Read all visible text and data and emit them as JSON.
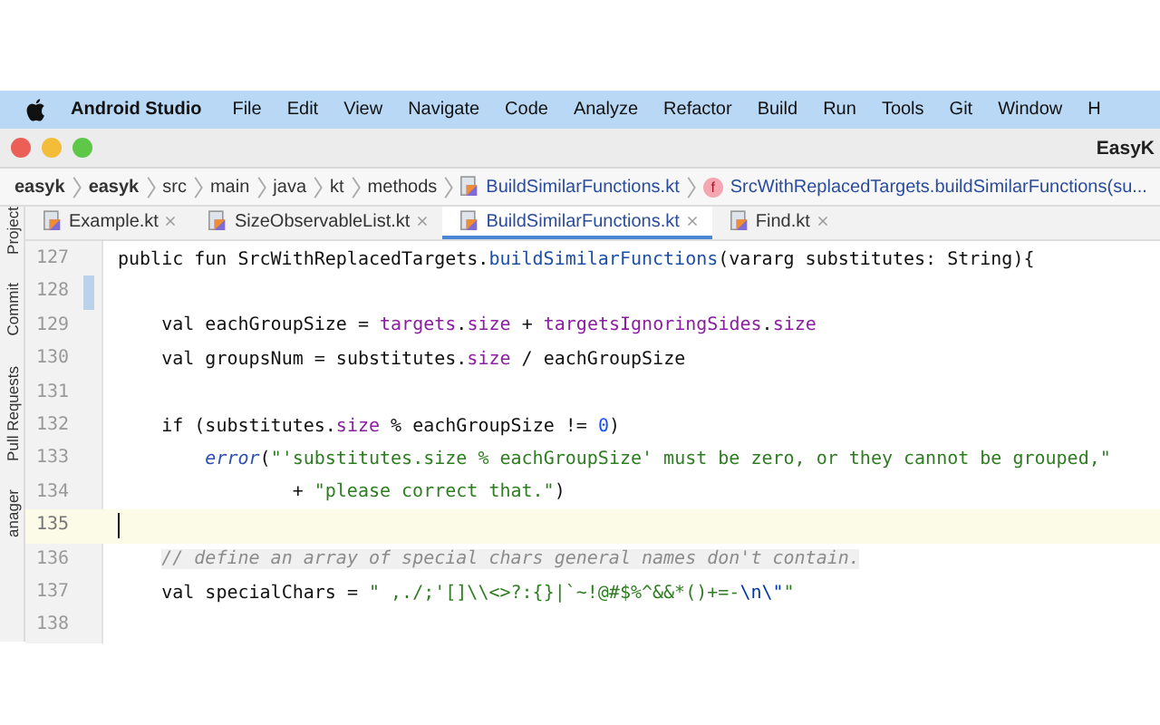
{
  "menu_bar": {
    "app_name": "Android Studio",
    "items": [
      "File",
      "Edit",
      "View",
      "Navigate",
      "Code",
      "Analyze",
      "Refactor",
      "Build",
      "Run",
      "Tools",
      "Git",
      "Window",
      "H"
    ]
  },
  "window": {
    "title": "EasyK"
  },
  "breadcrumb": [
    {
      "label": "easyk",
      "kind": "module"
    },
    {
      "label": "easyk",
      "kind": "module"
    },
    {
      "label": "src",
      "kind": "folder"
    },
    {
      "label": "main",
      "kind": "folder"
    },
    {
      "label": "java",
      "kind": "folder"
    },
    {
      "label": "kt",
      "kind": "folder"
    },
    {
      "label": "methods",
      "kind": "folder"
    },
    {
      "label": "BuildSimilarFunctions.kt",
      "kind": "file"
    },
    {
      "label": "SrcWithReplacedTargets.buildSimilarFunctions(su...",
      "kind": "function",
      "icon_letter": "f"
    }
  ],
  "side_tools": [
    "Project",
    "Commit",
    "Pull Requests",
    "anager"
  ],
  "tabs": [
    {
      "label": "Example.kt",
      "selected": false
    },
    {
      "label": "SizeObservableList.kt",
      "selected": false
    },
    {
      "label": "BuildSimilarFunctions.kt",
      "selected": true
    },
    {
      "label": "Find.kt",
      "selected": false
    }
  ],
  "editor": {
    "lines": [
      {
        "number": "127",
        "current": false,
        "changed": false,
        "tokens": [
          {
            "kind": "plain",
            "text": "public fun SrcWithReplacedTargets."
          },
          {
            "kind": "call",
            "text": "buildSimilarFunctions"
          },
          {
            "kind": "plain",
            "text": "(vararg substitutes: String){"
          }
        ]
      },
      {
        "number": "128",
        "current": false,
        "changed": true
      },
      {
        "number": "129",
        "current": false,
        "changed": false,
        "tokens": [
          {
            "kind": "plain",
            "text": "    val eachGroupSize = "
          },
          {
            "kind": "prop",
            "text": "targets"
          },
          {
            "kind": "plain",
            "text": "."
          },
          {
            "kind": "prop",
            "text": "size"
          },
          {
            "kind": "plain",
            "text": " + "
          },
          {
            "kind": "prop",
            "text": "targetsIgnoringSides"
          },
          {
            "kind": "plain",
            "text": "."
          },
          {
            "kind": "prop",
            "text": "size"
          }
        ]
      },
      {
        "number": "130",
        "current": false,
        "changed": false,
        "tokens": [
          {
            "kind": "plain",
            "text": "    val groupsNum = substitutes."
          },
          {
            "kind": "prop",
            "text": "size"
          },
          {
            "kind": "plain",
            "text": " / eachGroupSize"
          }
        ]
      },
      {
        "number": "131",
        "current": false,
        "changed": false
      },
      {
        "number": "132",
        "current": false,
        "changed": false,
        "tokens": [
          {
            "kind": "plain",
            "text": "    if (substitutes."
          },
          {
            "kind": "prop",
            "text": "size"
          },
          {
            "kind": "plain",
            "text": " % eachGroupSize != "
          },
          {
            "kind": "number",
            "text": "0"
          },
          {
            "kind": "plain",
            "text": ")"
          }
        ]
      },
      {
        "number": "133",
        "current": false,
        "changed": false,
        "tokens": [
          {
            "kind": "fn_italic",
            "text": "        error"
          },
          {
            "kind": "plain",
            "text": "("
          },
          {
            "kind": "string",
            "text": "\"'substitutes.size % eachGroupSize' must be zero, or they cannot be grouped,\""
          }
        ]
      },
      {
        "number": "134",
        "current": false,
        "changed": false,
        "tokens": [
          {
            "kind": "plain",
            "text": "                + "
          },
          {
            "kind": "string",
            "text": "\"please correct that.\""
          },
          {
            "kind": "plain",
            "text": ")"
          }
        ]
      },
      {
        "number": "135",
        "current": true,
        "changed": false
      },
      {
        "number": "136",
        "current": false,
        "changed": false,
        "tokens": [
          {
            "kind": "comment",
            "text": "    // define an array of special chars general names don't contain."
          }
        ]
      },
      {
        "number": "137",
        "current": false,
        "changed": false,
        "tokens": [
          {
            "kind": "plain",
            "text": "    val specialChars = "
          },
          {
            "kind": "string",
            "text": "\" ,./;'[]\\\\<>?:{}|`~!@#$%^&&*()+=-"
          },
          {
            "kind": "escape",
            "text": "\\n\\\""
          },
          {
            "kind": "string",
            "text": "\""
          }
        ]
      },
      {
        "number": "138",
        "current": false,
        "changed": false
      }
    ]
  }
}
